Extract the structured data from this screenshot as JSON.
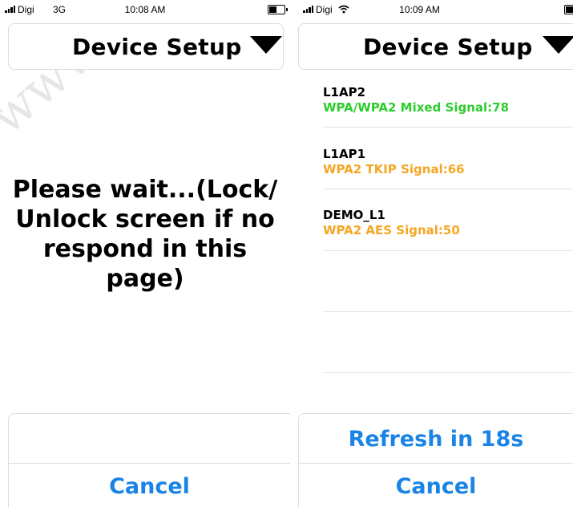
{
  "left": {
    "status": {
      "carrier": "Digi",
      "network": "3G",
      "time": "10:08 AM"
    },
    "header": {
      "title": "Device Setup"
    },
    "message": "Please wait...(Lock/ Unlock screen if no respond in this page)",
    "cancel_label": "Cancel",
    "watermark": "www."
  },
  "right": {
    "status": {
      "carrier": "Digi",
      "time": "10:09 AM"
    },
    "header": {
      "title": "Device Setup"
    },
    "access_points": [
      {
        "ssid": "L1AP2",
        "security": "WPA/WPA2 Mixed Signal:78",
        "color": "#2ecc2e"
      },
      {
        "ssid": "L1AP1",
        "security": "WPA2 TKIP Signal:66",
        "color": "#f5a623"
      },
      {
        "ssid": "DEMO_L1",
        "security": "WPA2 AES Signal:50",
        "color": "#f5a623"
      }
    ],
    "refresh_label": "Refresh in 18s",
    "cancel_label": "Cancel"
  },
  "colors": {
    "accent_blue": "#1a84e6",
    "signal_good": "#2ecc2e",
    "signal_fair": "#f5a623",
    "border": "#dcdcdc"
  }
}
